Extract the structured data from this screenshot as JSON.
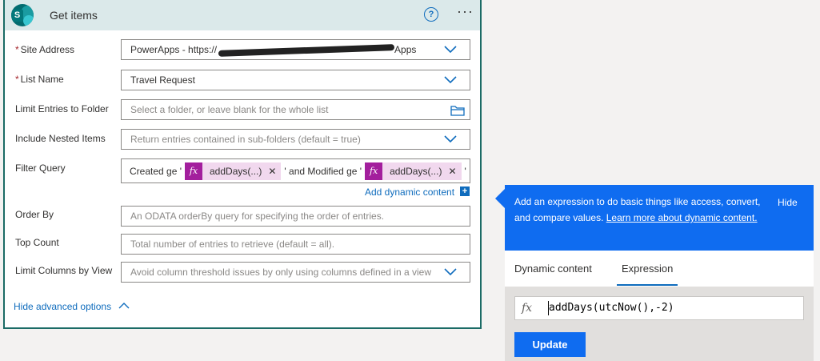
{
  "card": {
    "title": "Get items",
    "help_icon": "?",
    "more_icon": "···"
  },
  "fields": {
    "site_address": {
      "label": "Site Address",
      "value": "PowerApps - https://",
      "value_tail": "Apps"
    },
    "list_name": {
      "label": "List Name",
      "value": "Travel Request"
    },
    "limit_folder": {
      "label": "Limit Entries to Folder",
      "placeholder": "Select a folder, or leave blank for the whole list"
    },
    "nested": {
      "label": "Include Nested Items",
      "placeholder": "Return entries contained in sub-folders (default = true)"
    },
    "filter": {
      "label": "Filter Query",
      "part1": "Created ge '",
      "token1": "addDays(...)",
      "part2": "' and Modified ge '",
      "token2": "addDays(...)",
      "part3": "'"
    },
    "order_by": {
      "label": "Order By",
      "placeholder": "An ODATA orderBy query for specifying the order of entries."
    },
    "top_count": {
      "label": "Top Count",
      "placeholder": "Total number of entries to retrieve (default = all)."
    },
    "limit_columns": {
      "label": "Limit Columns by View",
      "placeholder": "Avoid column threshold issues by only using columns defined in a view"
    }
  },
  "required_mark": "*",
  "add_dynamic_content": "Add dynamic content",
  "hide_advanced": "Hide advanced options",
  "panel": {
    "description_1": "Add an expression to do basic things like access, convert, and compare values.",
    "learn_more": "Learn more about dynamic content.",
    "hide": "Hide",
    "tabs": [
      "Dynamic content",
      "Expression"
    ],
    "active_tab": "Expression",
    "fx_label": "fx",
    "expression": "addDays(utcNow(),-2)",
    "update_button": "Update"
  },
  "colors": {
    "accent": "#0f6cf0",
    "card_border": "#1b6b66",
    "header_bg": "#dbe9ea",
    "token_fx": "#a31f9d",
    "token_bg": "#f1d8ee"
  }
}
